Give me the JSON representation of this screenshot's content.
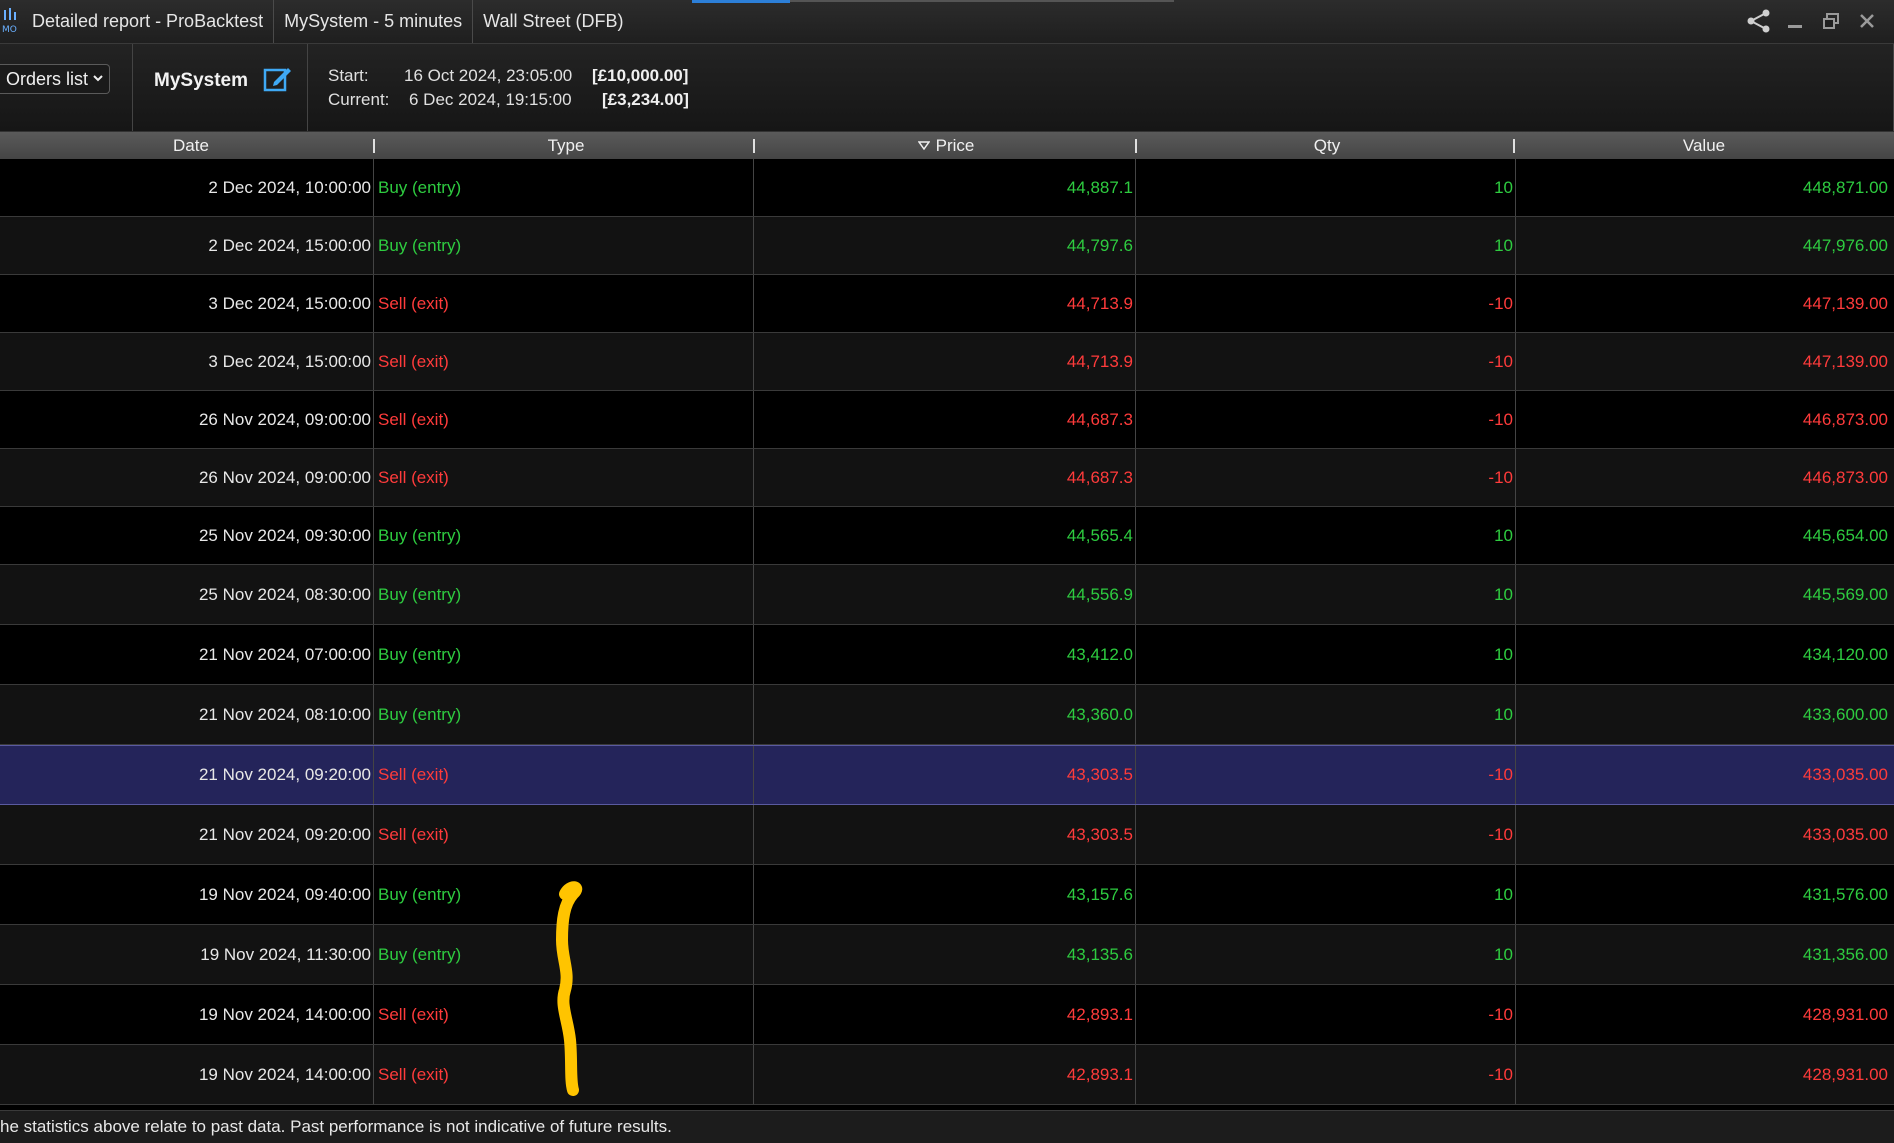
{
  "titlebar": {
    "title": "Detailed report - ProBacktest",
    "system_tab": "MySystem - 5 minutes",
    "instrument": "Wall Street (DFB)"
  },
  "infobar": {
    "view_select": "Orders list",
    "system_name": "MySystem",
    "start_label": "Start:",
    "start_value": "16 Oct 2024, 23:05:00",
    "start_money": "[£10,000.00]",
    "current_label": "Current:",
    "current_value": "6 Dec 2024, 19:15:00",
    "current_money": "[£3,234.00]"
  },
  "table": {
    "headers": {
      "date": "Date",
      "type": "Type",
      "price": "Price",
      "qty": "Qty",
      "value": "Value"
    },
    "sorted_column": "Price",
    "sort_direction": "descending",
    "rows": [
      {
        "date": "2 Dec 2024, 10:00:00",
        "type": "Buy (entry)",
        "price": "44,887.1",
        "qty": "10",
        "value": "448,871.00",
        "side": "buy"
      },
      {
        "date": "2 Dec 2024, 15:00:00",
        "type": "Buy (entry)",
        "price": "44,797.6",
        "qty": "10",
        "value": "447,976.00",
        "side": "buy"
      },
      {
        "date": "3 Dec 2024, 15:00:00",
        "type": "Sell (exit)",
        "price": "44,713.9",
        "qty": "-10",
        "value": "447,139.00",
        "side": "sell"
      },
      {
        "date": "3 Dec 2024, 15:00:00",
        "type": "Sell (exit)",
        "price": "44,713.9",
        "qty": "-10",
        "value": "447,139.00",
        "side": "sell"
      },
      {
        "date": "26 Nov 2024, 09:00:00",
        "type": "Sell (exit)",
        "price": "44,687.3",
        "qty": "-10",
        "value": "446,873.00",
        "side": "sell"
      },
      {
        "date": "26 Nov 2024, 09:00:00",
        "type": "Sell (exit)",
        "price": "44,687.3",
        "qty": "-10",
        "value": "446,873.00",
        "side": "sell"
      },
      {
        "date": "25 Nov 2024, 09:30:00",
        "type": "Buy (entry)",
        "price": "44,565.4",
        "qty": "10",
        "value": "445,654.00",
        "side": "buy"
      },
      {
        "date": "25 Nov 2024, 08:30:00",
        "type": "Buy (entry)",
        "price": "44,556.9",
        "qty": "10",
        "value": "445,569.00",
        "side": "buy"
      },
      {
        "date": "21 Nov 2024, 07:00:00",
        "type": "Buy (entry)",
        "price": "43,412.0",
        "qty": "10",
        "value": "434,120.00",
        "side": "buy"
      },
      {
        "date": "21 Nov 2024, 08:10:00",
        "type": "Buy (entry)",
        "price": "43,360.0",
        "qty": "10",
        "value": "433,600.00",
        "side": "buy"
      },
      {
        "date": "21 Nov 2024, 09:20:00",
        "type": "Sell (exit)",
        "price": "43,303.5",
        "qty": "-10",
        "value": "433,035.00",
        "side": "sell",
        "selected": true
      },
      {
        "date": "21 Nov 2024, 09:20:00",
        "type": "Sell (exit)",
        "price": "43,303.5",
        "qty": "-10",
        "value": "433,035.00",
        "side": "sell"
      },
      {
        "date": "19 Nov 2024, 09:40:00",
        "type": "Buy (entry)",
        "price": "43,157.6",
        "qty": "10",
        "value": "431,576.00",
        "side": "buy"
      },
      {
        "date": "19 Nov 2024, 11:30:00",
        "type": "Buy (entry)",
        "price": "43,135.6",
        "qty": "10",
        "value": "431,356.00",
        "side": "buy"
      },
      {
        "date": "19 Nov 2024, 14:00:00",
        "type": "Sell (exit)",
        "price": "42,893.1",
        "qty": "-10",
        "value": "428,931.00",
        "side": "sell"
      },
      {
        "date": "19 Nov 2024, 14:00:00",
        "type": "Sell (exit)",
        "price": "42,893.1",
        "qty": "-10",
        "value": "428,931.00",
        "side": "sell"
      }
    ]
  },
  "footer": {
    "disclaimer": "he statistics above relate to past data. Past performance is not indicative of future results."
  },
  "colors": {
    "buy": "#2ecc40",
    "sell": "#ff3b3b",
    "selected_row": "#24245a",
    "annotation": "#ffc400"
  },
  "icons": {
    "app": "prorealtime-logo-icon",
    "share": "share-icon",
    "minimize": "minimize-icon",
    "restore": "restore-icon",
    "close": "close-icon",
    "edit": "edit-icon",
    "sort": "sort-down-icon",
    "dropdown": "chevron-down-icon"
  }
}
